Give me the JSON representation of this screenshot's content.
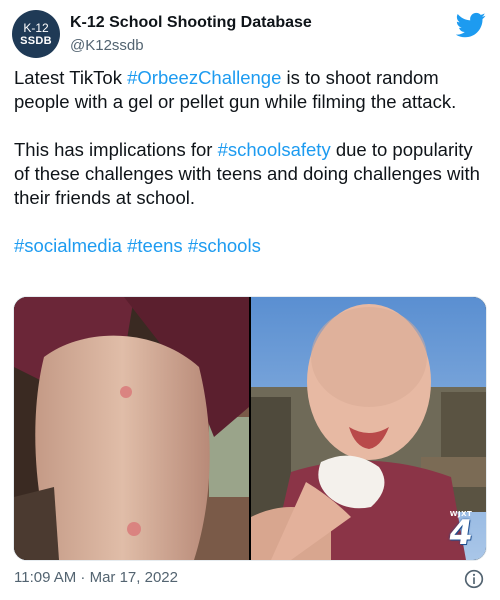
{
  "tweet": {
    "avatar": {
      "line1": "K-12",
      "line2": "SSDB",
      "color": "#1f3a56"
    },
    "display_name": "K-12 School Shooting Database",
    "handle": "@K12ssdb",
    "brand_icon": "twitter-bird-icon",
    "brand_color": "#1d9bf0",
    "text": {
      "p1_before": "Latest TikTok ",
      "p1_hashtag": "#OrbeezChallenge",
      "p1_after": " is to shoot random people with a gel or pellet gun while filming the attack.",
      "p2_before": "This has implications for ",
      "p2_hashtag": "#schoolsafety",
      "p2_after": " due to popularity of these challenges with teens and doing challenges with their friends at school.",
      "hashtags": [
        "#socialmedia",
        "#teens",
        "#schools"
      ]
    },
    "media": {
      "photo_left": "arm-with-welts-photo",
      "photo_right": "child-with-tissue-photo",
      "watermark_call": "WJXT",
      "watermark_number": "4"
    },
    "timestamp": "11:09 AM · Mar 17, 2022",
    "info_icon": "info-icon"
  }
}
